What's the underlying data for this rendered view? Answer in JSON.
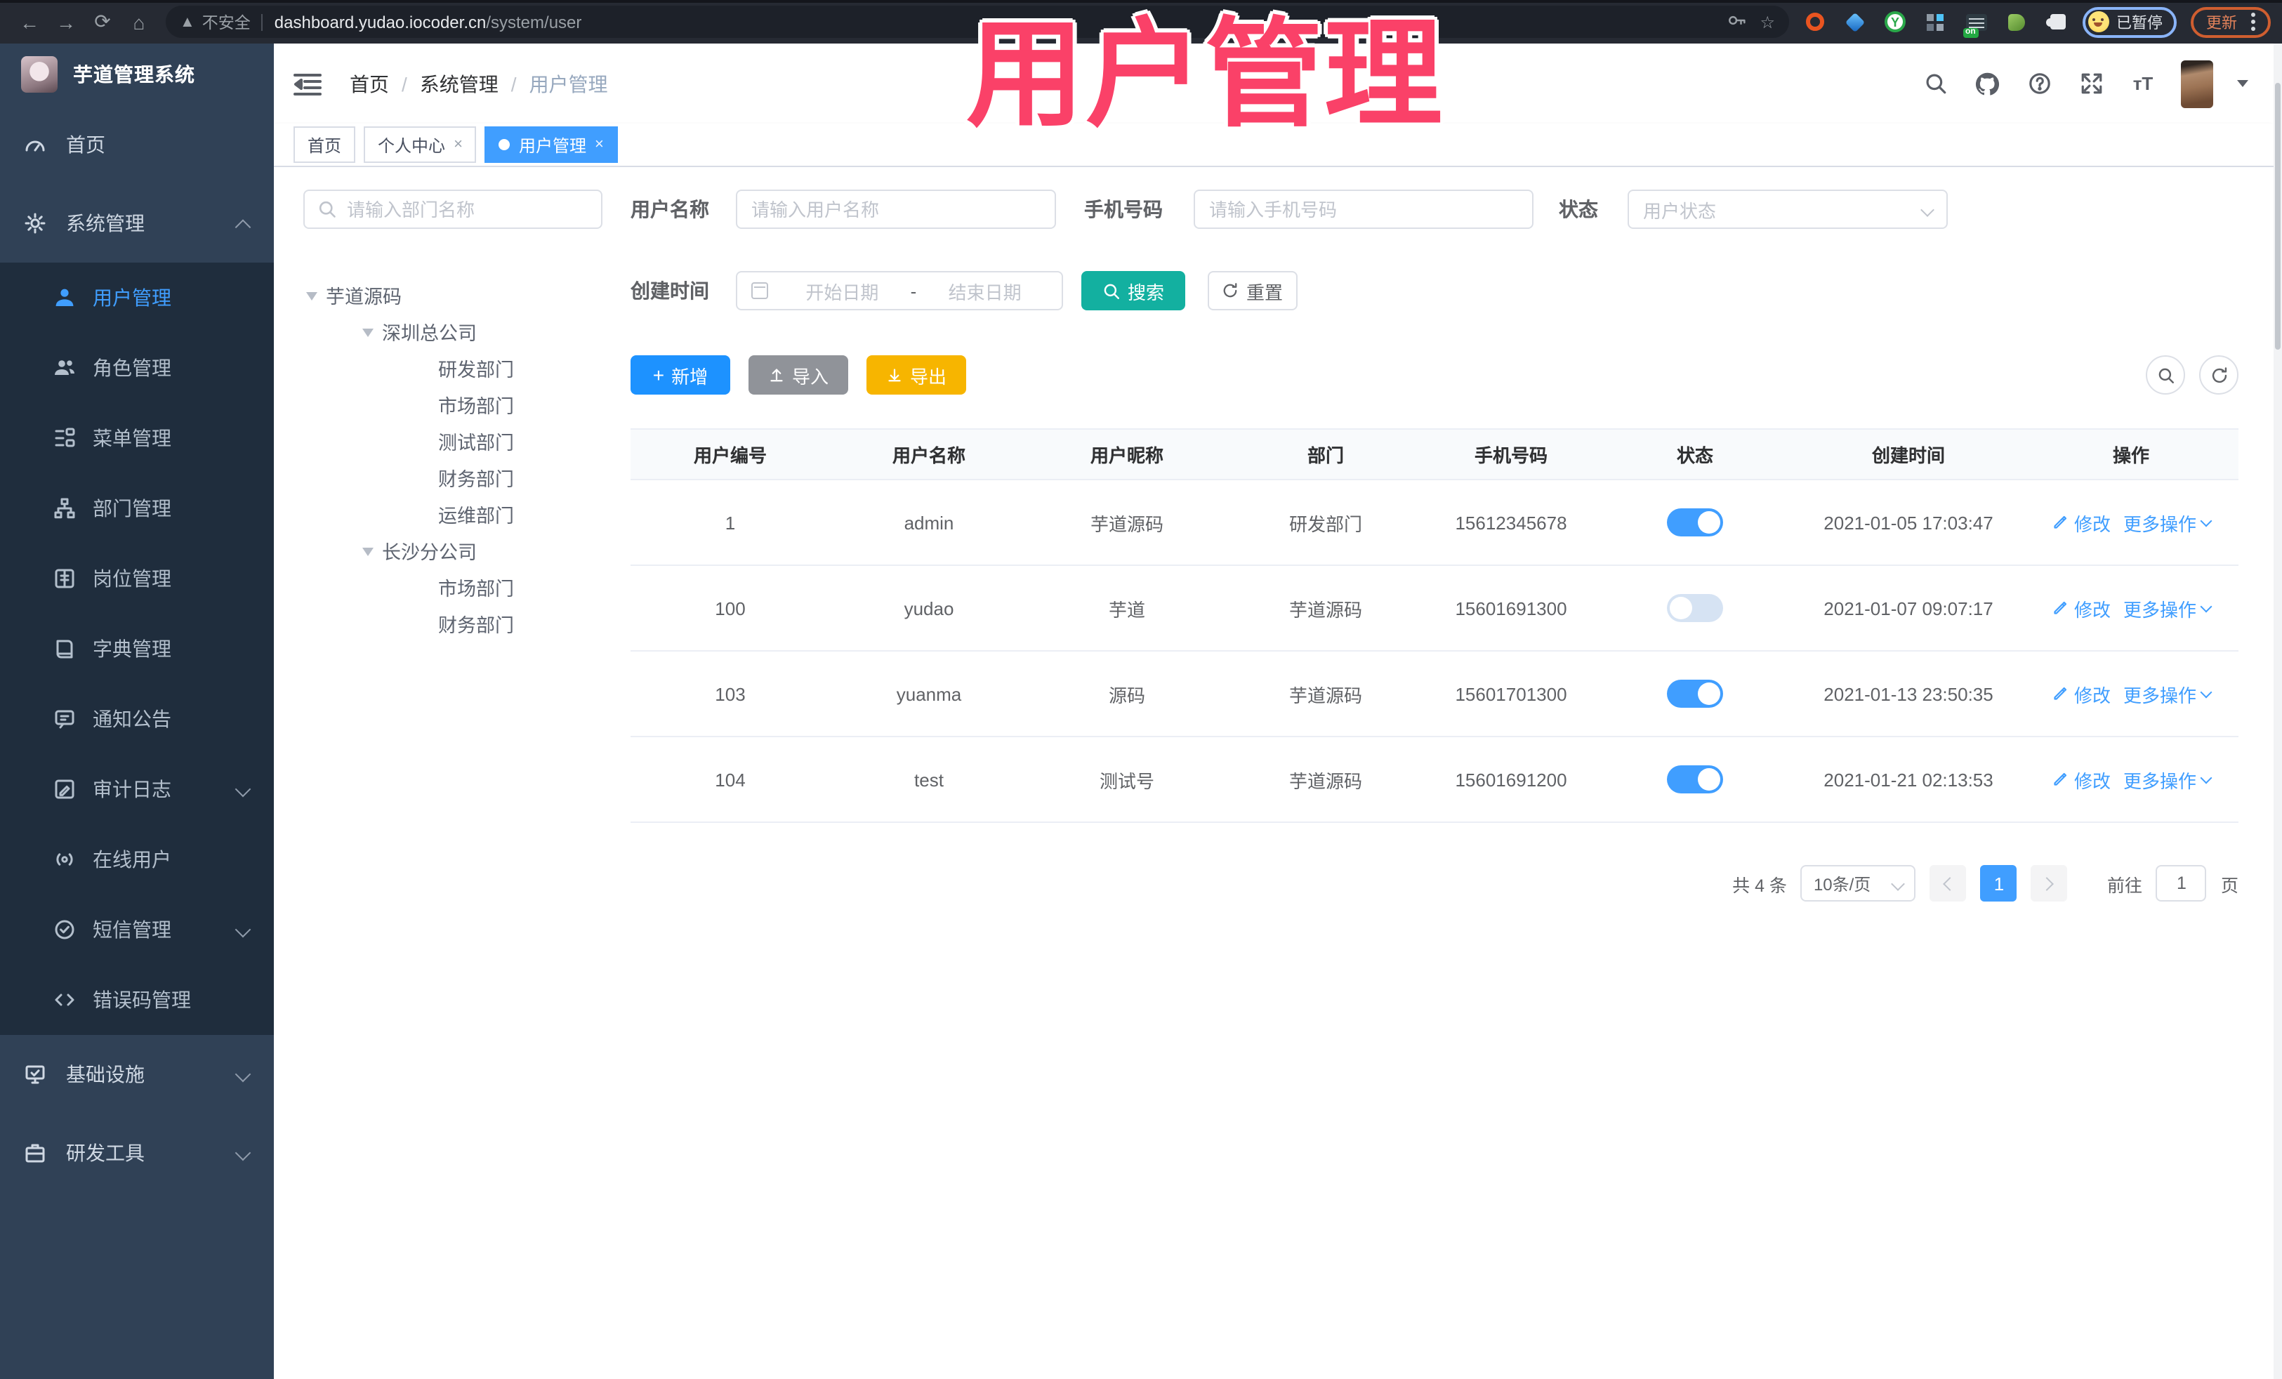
{
  "colors": {
    "accent": "#409eff",
    "teal_search": "#13b0a0",
    "amber_export": "#f7b500",
    "gray_import": "#909399",
    "pink_watermark": "#fa4168",
    "sidebar_bg": "#304156",
    "submenu_bg": "#1f2d3d",
    "active_tab": "#409eff",
    "switch_off": "#d6e3f3"
  },
  "icons": {
    "back": "left-arrow",
    "forward": "right-arrow",
    "reload": "circular-arrow",
    "home": "house",
    "warning": "triangle-exclaim",
    "key": "key",
    "star": "star-outline",
    "search": "magnifier",
    "github": "octocat-circle",
    "help": "question-circle",
    "fullscreen": "expand-arrows",
    "font_size": "Tt",
    "caret_down": "chevron-down",
    "edit": "pencil",
    "add": "plus",
    "import": "arrow-up",
    "export": "arrow-down",
    "calendar": "calendar",
    "refresh": "refresh-arrows",
    "close": "×",
    "kebab": "three-dots"
  },
  "watermark": "用户管理",
  "browser": {
    "security_label": "不安全",
    "url_host": "dashboard.yudao.iocoder.cn",
    "url_path": "/system/user",
    "ext_badge": "on",
    "ext_y_glyph": "Y",
    "profile_chip": "已暂停",
    "update_label": "更新"
  },
  "sidebar": {
    "title": "芋道管理系统",
    "items": [
      {
        "label": "首页"
      },
      {
        "label": "系统管理"
      },
      {
        "label": "用户管理"
      },
      {
        "label": "角色管理"
      },
      {
        "label": "菜单管理"
      },
      {
        "label": "部门管理"
      },
      {
        "label": "岗位管理"
      },
      {
        "label": "字典管理"
      },
      {
        "label": "通知公告"
      },
      {
        "label": "审计日志"
      },
      {
        "label": "在线用户"
      },
      {
        "label": "短信管理"
      },
      {
        "label": "错误码管理"
      },
      {
        "label": "基础设施"
      },
      {
        "label": "研发工具"
      }
    ]
  },
  "breadcrumb": {
    "items": [
      "首页",
      "系统管理",
      "用户管理"
    ],
    "separator": "/"
  },
  "tabs": {
    "close": "×",
    "items": [
      {
        "label": "首页"
      },
      {
        "label": "个人中心"
      },
      {
        "label": "用户管理"
      }
    ]
  },
  "dept": {
    "search_placeholder": "请输入部门名称",
    "tree": [
      "芋道源码",
      "深圳总公司",
      "研发部门",
      "市场部门",
      "测试部门",
      "财务部门",
      "运维部门",
      "长沙分公司",
      "市场部门",
      "财务部门"
    ]
  },
  "filters": {
    "username_label": "用户名称",
    "username_placeholder": "请输入用户名称",
    "mobile_label": "手机号码",
    "mobile_placeholder": "请输入手机号码",
    "status_label": "状态",
    "status_placeholder": "用户状态",
    "date_label": "创建时间",
    "date_start_placeholder": "开始日期",
    "date_separator": "-",
    "date_end_placeholder": "结束日期",
    "search_label": "搜索",
    "reset_label": "重置"
  },
  "toolbar": {
    "add": "新增",
    "import": "导入",
    "export": "导出"
  },
  "table": {
    "columns": [
      "用户编号",
      "用户名称",
      "用户昵称",
      "部门",
      "手机号码",
      "状态",
      "创建时间",
      "操作"
    ],
    "action_edit": "修改",
    "action_more": "更多操作",
    "rows": [
      {
        "id": "1",
        "username": "admin",
        "nickname": "芋道源码",
        "dept": "研发部门",
        "mobile": "15612345678",
        "status": "on",
        "created": "2021-01-05 17:03:47"
      },
      {
        "id": "100",
        "username": "yudao",
        "nickname": "芋道",
        "dept": "芋道源码",
        "mobile": "15601691300",
        "status": "off",
        "created": "2021-01-07 09:07:17"
      },
      {
        "id": "103",
        "username": "yuanma",
        "nickname": "源码",
        "dept": "芋道源码",
        "mobile": "15601701300",
        "status": "on",
        "created": "2021-01-13 23:50:35"
      },
      {
        "id": "104",
        "username": "test",
        "nickname": "测试号",
        "dept": "芋道源码",
        "mobile": "15601691200",
        "status": "on",
        "created": "2021-01-21 02:13:53"
      }
    ]
  },
  "pagination": {
    "total": "共 4 条",
    "page_size": "10条/页",
    "current_page": "1",
    "goto_label": "前往",
    "page_unit": "页"
  }
}
